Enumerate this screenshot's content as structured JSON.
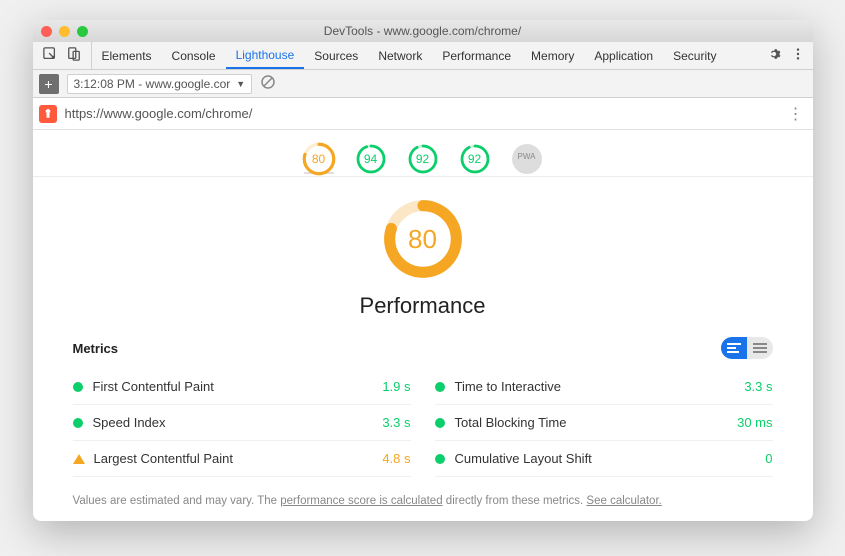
{
  "window": {
    "title": "DevTools - www.google.com/chrome/"
  },
  "tabs": {
    "items": [
      "Elements",
      "Console",
      "Lighthouse",
      "Sources",
      "Network",
      "Performance",
      "Memory",
      "Application",
      "Security"
    ],
    "active": "Lighthouse"
  },
  "subbar": {
    "timestamp": "3:12:08 PM - www.google.cor"
  },
  "urlbar": {
    "url": "https://www.google.com/chrome/"
  },
  "scoreTabs": {
    "items": [
      {
        "score": 80,
        "color": "#f5a623",
        "pct": 0.8
      },
      {
        "score": 94,
        "color": "#0cce6b",
        "pct": 0.94
      },
      {
        "score": 92,
        "color": "#0cce6b",
        "pct": 0.92
      },
      {
        "score": 92,
        "color": "#0cce6b",
        "pct": 0.92
      }
    ],
    "extraLabel": "PWA"
  },
  "bigGauge": {
    "score": 80,
    "color": "#f5a623",
    "pct": 0.8,
    "title": "Performance"
  },
  "metrics": {
    "heading": "Metrics",
    "left": [
      {
        "icon": "dot-green",
        "label": "First Contentful Paint",
        "value": "1.9 s",
        "valueClass": "green"
      },
      {
        "icon": "dot-green",
        "label": "Speed Index",
        "value": "3.3 s",
        "valueClass": "green"
      },
      {
        "icon": "tri-orange",
        "label": "Largest Contentful Paint",
        "value": "4.8 s",
        "valueClass": "orange"
      }
    ],
    "right": [
      {
        "icon": "dot-green",
        "label": "Time to Interactive",
        "value": "3.3 s",
        "valueClass": "green"
      },
      {
        "icon": "dot-green",
        "label": "Total Blocking Time",
        "value": "30 ms",
        "valueClass": "green"
      },
      {
        "icon": "dot-green",
        "label": "Cumulative Layout Shift",
        "value": "0",
        "valueClass": "green"
      }
    ]
  },
  "footnote": {
    "t1": "Values are estimated and may vary. The ",
    "t2": "performance score is calculated",
    "t3": " directly from these metrics. ",
    "t4": "See calculator."
  }
}
